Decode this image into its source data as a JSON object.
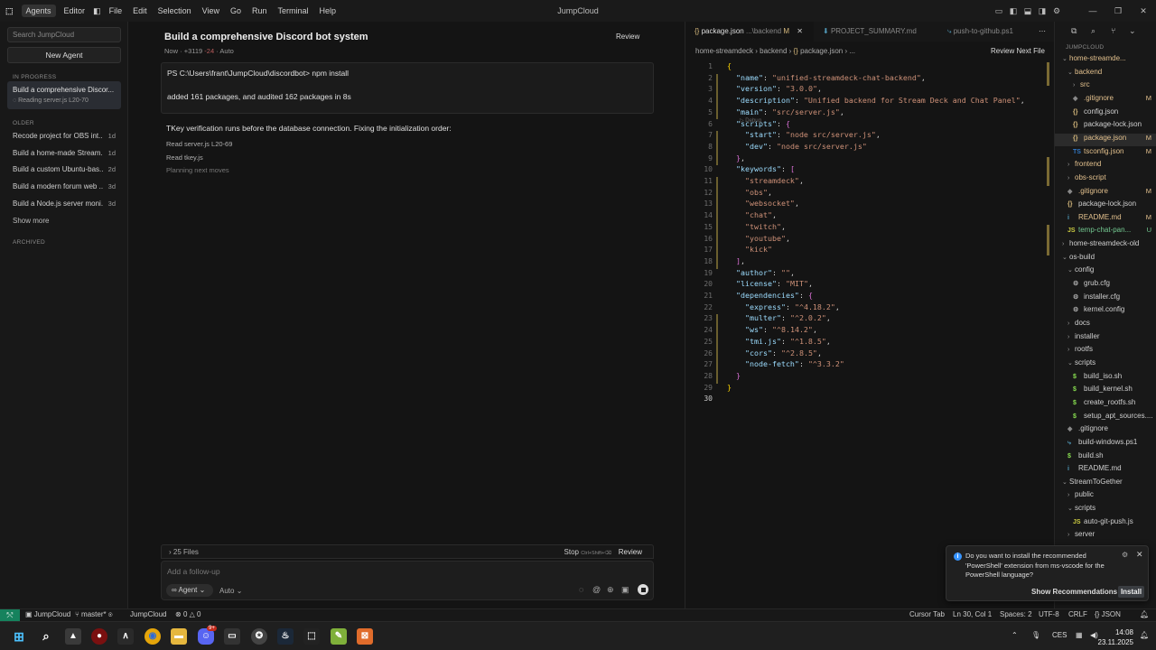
{
  "titlebar": {
    "title": "JumpCloud",
    "menu": [
      "Agents",
      "Editor",
      "File",
      "Edit",
      "Selection",
      "View",
      "Go",
      "Run",
      "Terminal",
      "Help"
    ]
  },
  "sidebar": {
    "search_placeholder": "Search JumpCloud",
    "new_agent": "New Agent",
    "in_progress_label": "IN PROGRESS",
    "active_chat": {
      "title": "Build a comprehensive Discor...",
      "status": "Reading server.js L20-70"
    },
    "older_label": "OLDER",
    "older": [
      {
        "title": "Recode project for OBS int...",
        "age": "1d"
      },
      {
        "title": "Build a home-made Stream...",
        "age": "1d"
      },
      {
        "title": "Build a custom Ubuntu-bas...",
        "age": "2d"
      },
      {
        "title": "Build a modern forum web ...",
        "age": "3d"
      },
      {
        "title": "Build a Node.js server moni...",
        "age": "3d"
      }
    ],
    "show_more": "Show more",
    "archived_label": "ARCHIVED"
  },
  "chat": {
    "title": "Build a comprehensive Discord bot system",
    "review": "Review",
    "meta_time": "Now",
    "meta_added": "+3119",
    "meta_removed": "-24",
    "meta_mode": "Auto",
    "terminal_cmd": "PS C:\\Users\\frant\\JumpCloud\\discordbot> npm install",
    "terminal_out": "added 161 packages, and audited 162 packages in 8s",
    "message": "TKey verification runs before the database connection. Fixing the initialization order:",
    "actions": [
      "Read server.js L20-69",
      "Read tkey.js",
      "Planning next moves"
    ],
    "files_label": "25 Files",
    "stop_label": "Stop",
    "stop_shortcut": "Ctrl+Shift+⌫",
    "review_label": "Review",
    "input_placeholder": "Add a follow-up",
    "agent_mode": "Agent",
    "auto_label": "Auto"
  },
  "editor": {
    "tabs": [
      {
        "name": "package.json",
        "path": "...\\backend",
        "status": "M"
      },
      {
        "name": "PROJECT_SUMMARY.md"
      },
      {
        "name": "push-to-github.ps1"
      }
    ],
    "breadcrumb": [
      "home-streamdeck",
      "backend",
      "package.json",
      "..."
    ],
    "review_next": "Review Next File",
    "debug_hint": "▷ Debug",
    "lines": [
      [
        {
          "t": "{",
          "c": "b"
        }
      ],
      [
        {
          "t": "  ",
          "c": "p"
        },
        {
          "t": "\"name\"",
          "c": "k"
        },
        {
          "t": ": ",
          "c": "p"
        },
        {
          "t": "\"unified-streamdeck-chat-backend\"",
          "c": "s"
        },
        {
          "t": ",",
          "c": "p"
        }
      ],
      [
        {
          "t": "  ",
          "c": "p"
        },
        {
          "t": "\"version\"",
          "c": "k"
        },
        {
          "t": ": ",
          "c": "p"
        },
        {
          "t": "\"3.0.0\"",
          "c": "s"
        },
        {
          "t": ",",
          "c": "p"
        }
      ],
      [
        {
          "t": "  ",
          "c": "p"
        },
        {
          "t": "\"description\"",
          "c": "k"
        },
        {
          "t": ": ",
          "c": "p"
        },
        {
          "t": "\"Unified backend for Stream Deck and Chat Panel\"",
          "c": "s"
        },
        {
          "t": ",",
          "c": "p"
        }
      ],
      [
        {
          "t": "  ",
          "c": "p"
        },
        {
          "t": "\"main\"",
          "c": "k"
        },
        {
          "t": ": ",
          "c": "p"
        },
        {
          "t": "\"src/server.js\"",
          "c": "s"
        },
        {
          "t": ",",
          "c": "p"
        }
      ],
      [
        {
          "t": "  ",
          "c": "p"
        },
        {
          "t": "\"scripts\"",
          "c": "k"
        },
        {
          "t": ": ",
          "c": "p"
        },
        {
          "t": "{",
          "c": "bb"
        }
      ],
      [
        {
          "t": "    ",
          "c": "p"
        },
        {
          "t": "\"start\"",
          "c": "k"
        },
        {
          "t": ": ",
          "c": "p"
        },
        {
          "t": "\"node src/server.js\"",
          "c": "s"
        },
        {
          "t": ",",
          "c": "p"
        }
      ],
      [
        {
          "t": "    ",
          "c": "p"
        },
        {
          "t": "\"dev\"",
          "c": "k"
        },
        {
          "t": ": ",
          "c": "p"
        },
        {
          "t": "\"node src/server.js\"",
          "c": "s"
        }
      ],
      [
        {
          "t": "  ",
          "c": "p"
        },
        {
          "t": "}",
          "c": "bb"
        },
        {
          "t": ",",
          "c": "p"
        }
      ],
      [
        {
          "t": "  ",
          "c": "p"
        },
        {
          "t": "\"keywords\"",
          "c": "k"
        },
        {
          "t": ": ",
          "c": "p"
        },
        {
          "t": "[",
          "c": "bb"
        }
      ],
      [
        {
          "t": "    ",
          "c": "p"
        },
        {
          "t": "\"streamdeck\"",
          "c": "s"
        },
        {
          "t": ",",
          "c": "p"
        }
      ],
      [
        {
          "t": "    ",
          "c": "p"
        },
        {
          "t": "\"obs\"",
          "c": "s"
        },
        {
          "t": ",",
          "c": "p"
        }
      ],
      [
        {
          "t": "    ",
          "c": "p"
        },
        {
          "t": "\"websocket\"",
          "c": "s"
        },
        {
          "t": ",",
          "c": "p"
        }
      ],
      [
        {
          "t": "    ",
          "c": "p"
        },
        {
          "t": "\"chat\"",
          "c": "s"
        },
        {
          "t": ",",
          "c": "p"
        }
      ],
      [
        {
          "t": "    ",
          "c": "p"
        },
        {
          "t": "\"twitch\"",
          "c": "s"
        },
        {
          "t": ",",
          "c": "p"
        }
      ],
      [
        {
          "t": "    ",
          "c": "p"
        },
        {
          "t": "\"youtube\"",
          "c": "s"
        },
        {
          "t": ",",
          "c": "p"
        }
      ],
      [
        {
          "t": "    ",
          "c": "p"
        },
        {
          "t": "\"kick\"",
          "c": "s"
        }
      ],
      [
        {
          "t": "  ",
          "c": "p"
        },
        {
          "t": "]",
          "c": "bb"
        },
        {
          "t": ",",
          "c": "p"
        }
      ],
      [
        {
          "t": "  ",
          "c": "p"
        },
        {
          "t": "\"author\"",
          "c": "k"
        },
        {
          "t": ": ",
          "c": "p"
        },
        {
          "t": "\"\"",
          "c": "s"
        },
        {
          "t": ",",
          "c": "p"
        }
      ],
      [
        {
          "t": "  ",
          "c": "p"
        },
        {
          "t": "\"license\"",
          "c": "k"
        },
        {
          "t": ": ",
          "c": "p"
        },
        {
          "t": "\"MIT\"",
          "c": "s"
        },
        {
          "t": ",",
          "c": "p"
        }
      ],
      [
        {
          "t": "  ",
          "c": "p"
        },
        {
          "t": "\"dependencies\"",
          "c": "k"
        },
        {
          "t": ": ",
          "c": "p"
        },
        {
          "t": "{",
          "c": "bb"
        }
      ],
      [
        {
          "t": "    ",
          "c": "p"
        },
        {
          "t": "\"express\"",
          "c": "k"
        },
        {
          "t": ": ",
          "c": "p"
        },
        {
          "t": "\"^4.18.2\"",
          "c": "s"
        },
        {
          "t": ",",
          "c": "p"
        }
      ],
      [
        {
          "t": "    ",
          "c": "p"
        },
        {
          "t": "\"multer\"",
          "c": "k"
        },
        {
          "t": ": ",
          "c": "p"
        },
        {
          "t": "\"^2.0.2\"",
          "c": "s"
        },
        {
          "t": ",",
          "c": "p"
        }
      ],
      [
        {
          "t": "    ",
          "c": "p"
        },
        {
          "t": "\"ws\"",
          "c": "k"
        },
        {
          "t": ": ",
          "c": "p"
        },
        {
          "t": "\"^8.14.2\"",
          "c": "s"
        },
        {
          "t": ",",
          "c": "p"
        }
      ],
      [
        {
          "t": "    ",
          "c": "p"
        },
        {
          "t": "\"tmi.js\"",
          "c": "k"
        },
        {
          "t": ": ",
          "c": "p"
        },
        {
          "t": "\"^1.8.5\"",
          "c": "s"
        },
        {
          "t": ",",
          "c": "p"
        }
      ],
      [
        {
          "t": "    ",
          "c": "p"
        },
        {
          "t": "\"cors\"",
          "c": "k"
        },
        {
          "t": ": ",
          "c": "p"
        },
        {
          "t": "\"^2.8.5\"",
          "c": "s"
        },
        {
          "t": ",",
          "c": "p"
        }
      ],
      [
        {
          "t": "    ",
          "c": "p"
        },
        {
          "t": "\"node-fetch\"",
          "c": "k"
        },
        {
          "t": ": ",
          "c": "p"
        },
        {
          "t": "\"^3.3.2\"",
          "c": "s"
        }
      ],
      [
        {
          "t": "  ",
          "c": "p"
        },
        {
          "t": "}",
          "c": "bb"
        }
      ],
      [
        {
          "t": "}",
          "c": "b"
        }
      ],
      [
        {
          "t": "",
          "c": "p"
        }
      ]
    ]
  },
  "explorer": {
    "section": "JUMPCLOUD",
    "items": [
      {
        "n": "home-streamde...",
        "lvl": 1,
        "type": "dir",
        "open": true,
        "cls": "mod"
      },
      {
        "n": "backend",
        "lvl": 2,
        "type": "dir",
        "open": true,
        "cls": "mod"
      },
      {
        "n": "src",
        "lvl": 3,
        "type": "dir",
        "open": false,
        "cls": "mod"
      },
      {
        "n": ".gitignore",
        "lvl": 3,
        "type": "git",
        "st": "M",
        "cls": "mod"
      },
      {
        "n": "config.json",
        "lvl": 3,
        "type": "json",
        "cls": ""
      },
      {
        "n": "package-lock.json",
        "lvl": 3,
        "type": "json",
        "cls": ""
      },
      {
        "n": "package.json",
        "lvl": 3,
        "type": "json",
        "st": "M",
        "cls": "mod",
        "sel": true
      },
      {
        "n": "tsconfig.json",
        "lvl": 3,
        "type": "ts",
        "st": "M",
        "cls": "mod"
      },
      {
        "n": "frontend",
        "lvl": 2,
        "type": "dir",
        "open": false,
        "cls": "mod"
      },
      {
        "n": "obs-script",
        "lvl": 2,
        "type": "dir",
        "open": false,
        "cls": "mod"
      },
      {
        "n": ".gitignore",
        "lvl": 2,
        "type": "git",
        "st": "M",
        "cls": "mod"
      },
      {
        "n": "package-lock.json",
        "lvl": 2,
        "type": "json",
        "cls": ""
      },
      {
        "n": "README.md",
        "lvl": 2,
        "type": "md",
        "st": "M",
        "cls": "mod"
      },
      {
        "n": "temp-chat-pan...",
        "lvl": 2,
        "type": "js",
        "st": "U",
        "cls": "unt"
      },
      {
        "n": "home-streamdeck-old",
        "lvl": 1,
        "type": "dir",
        "open": false,
        "cls": ""
      },
      {
        "n": "os-build",
        "lvl": 1,
        "type": "dir",
        "open": true,
        "cls": ""
      },
      {
        "n": "config",
        "lvl": 2,
        "type": "dir",
        "open": true,
        "cls": ""
      },
      {
        "n": "grub.cfg",
        "lvl": 3,
        "type": "cfg",
        "cls": ""
      },
      {
        "n": "installer.cfg",
        "lvl": 3,
        "type": "cfg",
        "cls": ""
      },
      {
        "n": "kernel.config",
        "lvl": 3,
        "type": "cfg",
        "cls": ""
      },
      {
        "n": "docs",
        "lvl": 2,
        "type": "dir",
        "open": false,
        "cls": ""
      },
      {
        "n": "installer",
        "lvl": 2,
        "type": "dir",
        "open": false,
        "cls": ""
      },
      {
        "n": "rootfs",
        "lvl": 2,
        "type": "dir",
        "open": false,
        "cls": ""
      },
      {
        "n": "scripts",
        "lvl": 2,
        "type": "dir",
        "open": true,
        "cls": ""
      },
      {
        "n": "build_iso.sh",
        "lvl": 3,
        "type": "sh",
        "cls": ""
      },
      {
        "n": "build_kernel.sh",
        "lvl": 3,
        "type": "sh",
        "cls": ""
      },
      {
        "n": "create_rootfs.sh",
        "lvl": 3,
        "type": "sh",
        "cls": ""
      },
      {
        "n": "setup_apt_sources....",
        "lvl": 3,
        "type": "sh",
        "cls": ""
      },
      {
        "n": ".gitignore",
        "lvl": 2,
        "type": "git",
        "cls": ""
      },
      {
        "n": "build-windows.ps1",
        "lvl": 2,
        "type": "ps",
        "cls": ""
      },
      {
        "n": "build.sh",
        "lvl": 2,
        "type": "sh",
        "cls": ""
      },
      {
        "n": "README.md",
        "lvl": 2,
        "type": "md",
        "cls": ""
      },
      {
        "n": "StreamToGether",
        "lvl": 1,
        "type": "dir",
        "open": true,
        "cls": ""
      },
      {
        "n": "public",
        "lvl": 2,
        "type": "dir",
        "open": false,
        "cls": ""
      },
      {
        "n": "scripts",
        "lvl": 2,
        "type": "dir",
        "open": true,
        "cls": ""
      },
      {
        "n": "auto-git-push.js",
        "lvl": 3,
        "type": "js",
        "cls": ""
      },
      {
        "n": "server",
        "lvl": 2,
        "type": "dir",
        "open": false,
        "cls": ""
      }
    ]
  },
  "notification": {
    "text": "Do you want to install the recommended 'PowerShell' extension from ms-vscode for the PowerShell language?",
    "show": "Show Recommendations",
    "install": "Install"
  },
  "statusbar": {
    "workspace": "JumpCloud",
    "branch": "master*",
    "account": "JumpCloud",
    "errors": "0",
    "warnings": "0",
    "cursor_tab": "Cursor Tab",
    "position": "Ln 30, Col 1",
    "spaces": "Spaces: 2",
    "encoding": "UTF-8",
    "eol": "CRLF",
    "language": "{} JSON"
  },
  "taskbar": {
    "lang": "CES",
    "time": "14:08",
    "date": "23.11.2025",
    "badge": "9+"
  },
  "colors": {
    "accent": "#16825d",
    "modified": "#e2c08d",
    "untracked": "#73c991",
    "string": "#ce9178",
    "key": "#9cdcfe"
  }
}
